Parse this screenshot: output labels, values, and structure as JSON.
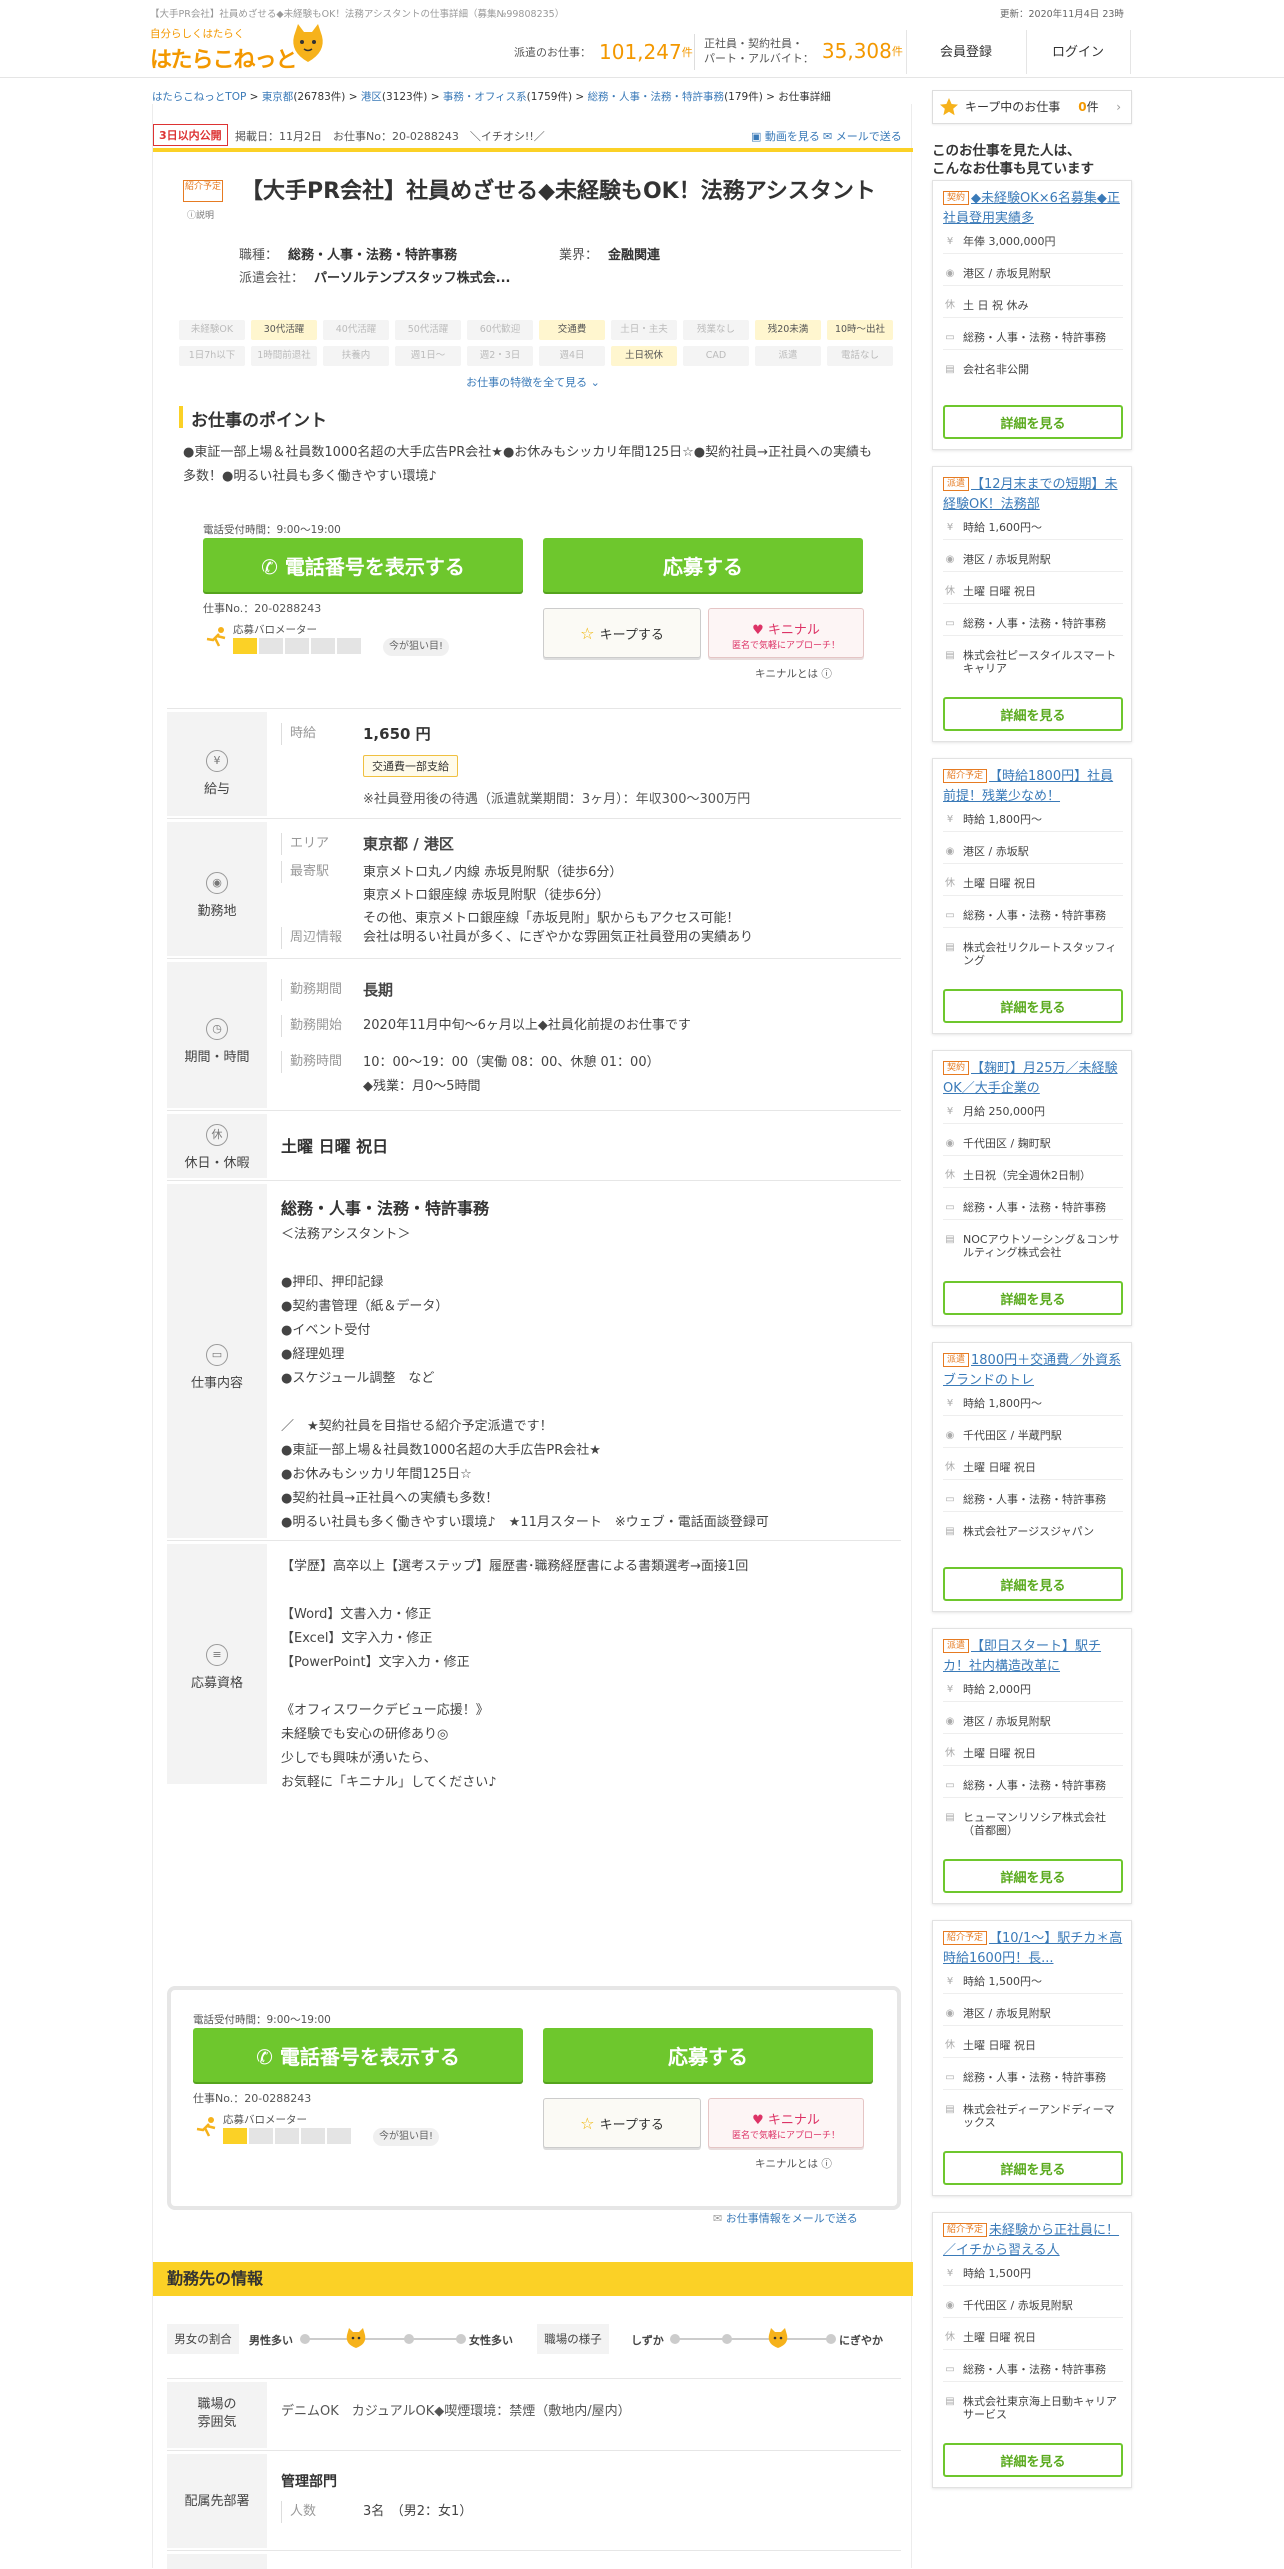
{
  "header": {
    "top_text": "【大手PR会社】社員めざせる◆未経験もOK！法務アシスタントの仕事詳細（募集№99808235）",
    "updated": "更新：2020年11月4日 23時",
    "logo_tag": "自分らしくはたらく",
    "logo_name": "はたらこねっと",
    "stat1_label": "派遣のお仕事：",
    "stat1_value": "101,247",
    "stat1_unit": "件",
    "stat2_label_1": "正社員・契約社員・",
    "stat2_label_2": "パート・アルバイト：",
    "stat2_value": "35,308",
    "stat2_unit": "件",
    "register_label": "会員登録",
    "login_label": "ログイン"
  },
  "breadcrumb": {
    "items": [
      "はたらこねっとTOP",
      "東京都",
      "港区",
      "事務・オフィス系",
      "総務・人事・法務・特許事務",
      "お仕事詳細"
    ],
    "counts": [
      "(26783件)",
      "(3123件)",
      "(1759件)",
      "(179件)"
    ],
    "sep": ">"
  },
  "job": {
    "badge": "3日以内公開",
    "posted": "掲載日：11月2日　お仕事No：20-0288243　＼イチオシ!!／",
    "share_video": "動画を見る",
    "share_mail": "メールで送る",
    "shokai_tag": "紹介予定",
    "setsumei": "説明",
    "title": "【大手PR会社】社員めざせる◆未経験もOK！法務アシスタント",
    "occupation_label": "職種：",
    "occupation": "総務・人事・法務・特許事務",
    "industry_label": "業界：",
    "industry": "金融関連",
    "agency_label": "派遣会社：",
    "agency": "パーソルテンプスタッフ株式会...",
    "chips": [
      {
        "label": "未経験OK",
        "on": false
      },
      {
        "label": "30代活躍",
        "on": true
      },
      {
        "label": "40代活躍",
        "on": false
      },
      {
        "label": "50代活躍",
        "on": false
      },
      {
        "label": "60代歓迎",
        "on": false
      },
      {
        "label": "交通費",
        "on": true
      },
      {
        "label": "土日・主夫",
        "on": false
      },
      {
        "label": "残業なし",
        "on": false
      },
      {
        "label": "残20未満",
        "on": true
      },
      {
        "label": "10時～出社",
        "on": true
      },
      {
        "label": "1日7h以下",
        "on": false
      },
      {
        "label": "1時間前退社",
        "on": false
      },
      {
        "label": "扶養内",
        "on": false
      },
      {
        "label": "週1日～",
        "on": false
      },
      {
        "label": "週2・3日",
        "on": false
      },
      {
        "label": "週4日",
        "on": false
      },
      {
        "label": "土日祝休",
        "on": true
      },
      {
        "label": "CAD",
        "on": false
      },
      {
        "label": "派遣",
        "on": false
      },
      {
        "label": "電話なし",
        "on": false
      }
    ],
    "more_attrs": "お仕事の特徴を全て見る ⌄",
    "point_heading": "お仕事のポイント",
    "point_text": "●東証一部上場＆社員数1000名超の大手広告PR会社★●お休みもシッカリ年間125日☆●契約社員→正社員への実績も多数！●明るい社員も多く働きやすい環境♪"
  },
  "cta": {
    "phone_hours": "電話受付時間：9:00～19:00",
    "phone_button": "電話番号を表示する",
    "apply_button": "応募する",
    "job_no": "仕事No.：20-0288243",
    "param_label": "応募バロメーター",
    "param_level": 1,
    "param_total": 5,
    "now_badge": "今が狙い目!",
    "keep_button": "キープする",
    "kinin_title": "キニナル",
    "kinin_sub": "匿名で気軽にアプローチ！",
    "kinin_help": "キニナルとは"
  },
  "details": {
    "salary": {
      "label": "給与",
      "icon": "yen-icon",
      "k1": "時給",
      "amount": "1,650 円",
      "transport": "交通費一部支給",
      "note": "※社員登用後の待遇（派遣就業期間：3ヶ月）：年収300～300万円"
    },
    "location": {
      "label": "勤務地",
      "k1": "エリア",
      "area": "東京都 / 港区",
      "k2": "最寄駅",
      "stations": "東京メトロ丸ノ内線 赤坂見附駅（徒歩6分）\n東京メトロ銀座線 赤坂見附駅（徒歩6分）\nその他、東京メトロ銀座線「赤坂見附」駅からもアクセス可能！",
      "k3": "周辺情報",
      "nearby": "会社は明るい社員が多く、にぎやかな雰囲気正社員登用の実績あり"
    },
    "period": {
      "label": "期間・時間",
      "k1": "勤務期間",
      "term": "長期",
      "k2": "勤務開始",
      "start": "2020年11月中旬～6ヶ月以上◆社員化前提のお仕事です",
      "k3": "勤務時間",
      "hours": "10：00～19：00（実働 08：00、休憩 01：00）\n◆残業：月0～5時間"
    },
    "holiday": {
      "label": "休日・休暇",
      "icon_text": "休",
      "value": "土曜 日曜 祝日"
    },
    "work": {
      "label": "仕事内容",
      "heading": "総務・人事・法務・特許事務",
      "body": "＜法務アシスタント＞\n\n●押印、押印記録\n●契約書管理（紙＆データ）\n●イベント受付\n●経理処理\n●スケジュール調整　など\n\n／　★契約社員を目指せる紹介予定派遣です！\n●東証一部上場＆社員数1000名超の大手広告PR会社★\n●お休みもシッカリ年間125日☆\n●契約社員→正社員への実績も多数！\n●明るい社員も多く働きやすい環境♪　★11月スタート　※ウェブ・電話面談登録可"
    },
    "qualification": {
      "label": "応募資格",
      "body": "【学歴】高卒以上【選考ステップ】履歴書･職務経歴書による書類選考→面接1回\n\n【Word】文書入力・修正\n【Excel】文字入力・修正\n【PowerPoint】文字入力・修正\n\n《オフィスワークデビュー応援！》\n未経験でも安心の研修あり◎\n少しでも興味が湧いたら、\nお気軽に「キニナル」してください♪"
    }
  },
  "mail_share": "お仕事情報をメールで送る",
  "workplace": {
    "heading": "勤務先の情報",
    "gender_label": "男女の割合",
    "gender_left": "男性多い",
    "gender_right": "女性多い",
    "gender_level": 0.33,
    "mood_label": "職場の様子",
    "mood_left": "しずか",
    "mood_right": "にぎやか",
    "mood_level": 0.66,
    "atmos_label": "職場の\n雰囲気",
    "atmos_value": "デニムOK　カジュアルOK◆喫煙環境：禁煙（敷地内/屋内）",
    "dept_label": "配属先部署",
    "dept_value": "管理部門",
    "people_k": "人数",
    "people_v": "3名　（男2：女1）"
  },
  "sidebar": {
    "keep_label": "キープ中のお仕事",
    "keep_count": "0",
    "keep_unit": "件",
    "heading": "このお仕事を見た人は、\nこんなお仕事も見ています",
    "cards": [
      {
        "tag": "契約",
        "title": "◆未経験OK×6名募集◆正社員登用実績多",
        "pay": "年俸 3,000,000円",
        "loc": "港区 / 赤坂見附駅",
        "hol": "土 日 祝 休み",
        "job": "総務・人事・法務・特許事務",
        "co": "会社名非公開",
        "btn": "詳細を見る"
      },
      {
        "tag": "派遣",
        "title": "【12月末までの短期】未経験OK！法務部",
        "pay": "時給 1,600円～",
        "loc": "港区 / 赤坂見附駅",
        "hol": "土曜 日曜 祝日",
        "job": "総務・人事・法務・特許事務",
        "co": "株式会社ピースタイルスマートキャリア",
        "btn": "詳細を見る"
      },
      {
        "tag": "紹介予定",
        "title": "【時給1800円】社員前提！残業少なめ！",
        "pay": "時給 1,800円～",
        "loc": "港区 / 赤坂駅",
        "hol": "土曜 日曜 祝日",
        "job": "総務・人事・法務・特許事務",
        "co": "株式会社リクルートスタッフィング",
        "btn": "詳細を見る"
      },
      {
        "tag": "契約",
        "title": "【麹町】月25万／未経験OK／大手企業の",
        "pay": "月給 250,000円",
        "loc": "千代田区 / 麹町駅",
        "hol": "土日祝（完全週休2日制）",
        "job": "総務・人事・法務・特許事務",
        "co": "NOCアウトソーシング＆コンサルティング株式会社",
        "btn": "詳細を見る"
      },
      {
        "tag": "派遣",
        "title": "1800円＋交通費／外資系ブランドのトレ",
        "pay": "時給 1,800円～",
        "loc": "千代田区 / 半蔵門駅",
        "hol": "土曜 日曜 祝日",
        "job": "総務・人事・法務・特許事務",
        "co": "株式会社アージスジャパン",
        "btn": "詳細を見る"
      },
      {
        "tag": "派遣",
        "title": "【即日スタート】駅チカ！社内構造改革に",
        "pay": "時給 2,000円",
        "loc": "港区 / 赤坂見附駅",
        "hol": "土曜 日曜 祝日",
        "job": "総務・人事・法務・特許事務",
        "co": "ヒューマンリソシア株式会社（首都圏）",
        "btn": "詳細を見る"
      },
      {
        "tag": "紹介予定",
        "title": "【10/1～】駅チカ＊高時給1600円！長...",
        "pay": "時給 1,500円～",
        "loc": "港区 / 赤坂見附駅",
        "hol": "土曜 日曜 祝日",
        "job": "総務・人事・法務・特許事務",
        "co": "株式会社ディーアンドディーマックス",
        "btn": "詳細を見る"
      },
      {
        "tag": "紹介予定",
        "title": "未経験から正社員に！／イチから習える人",
        "pay": "時給 1,500円",
        "loc": "千代田区 / 赤坂見附駅",
        "hol": "土曜 日曜 祝日",
        "job": "総務・人事・法務・特許事務",
        "co": "株式会社東京海上日動キャリアサービス",
        "btn": "詳細を見る"
      }
    ]
  },
  "colors": {
    "accent": "#f39800",
    "yellow": "#fbd126",
    "green": "#6ec72d",
    "link": "#3a7ab8"
  }
}
